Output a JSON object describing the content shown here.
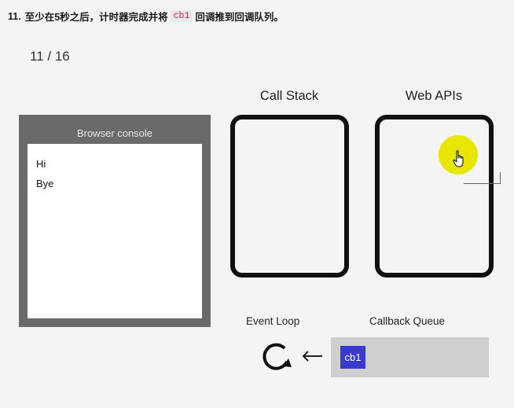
{
  "heading": {
    "number": "11.",
    "text_before": "至少在5秒之后，计时器完成并将",
    "code": "cb1",
    "text_after": "回调推到回调队列。"
  },
  "counter": "11 / 16",
  "browser_console": {
    "title": "Browser console",
    "lines": [
      "Hi",
      "Bye"
    ]
  },
  "call_stack": {
    "title": "Call Stack"
  },
  "web_apis": {
    "title": "Web APIs"
  },
  "event_loop": {
    "label": "Event Loop",
    "icon": "refresh-loop-icon"
  },
  "callback_queue": {
    "label": "Callback Queue",
    "items": [
      "cb1"
    ]
  },
  "colors": {
    "highlight": "#e8e600",
    "chip": "#3a3ad1",
    "console_frame": "#6a6a6a",
    "queue_bg": "#cfcfcf"
  }
}
